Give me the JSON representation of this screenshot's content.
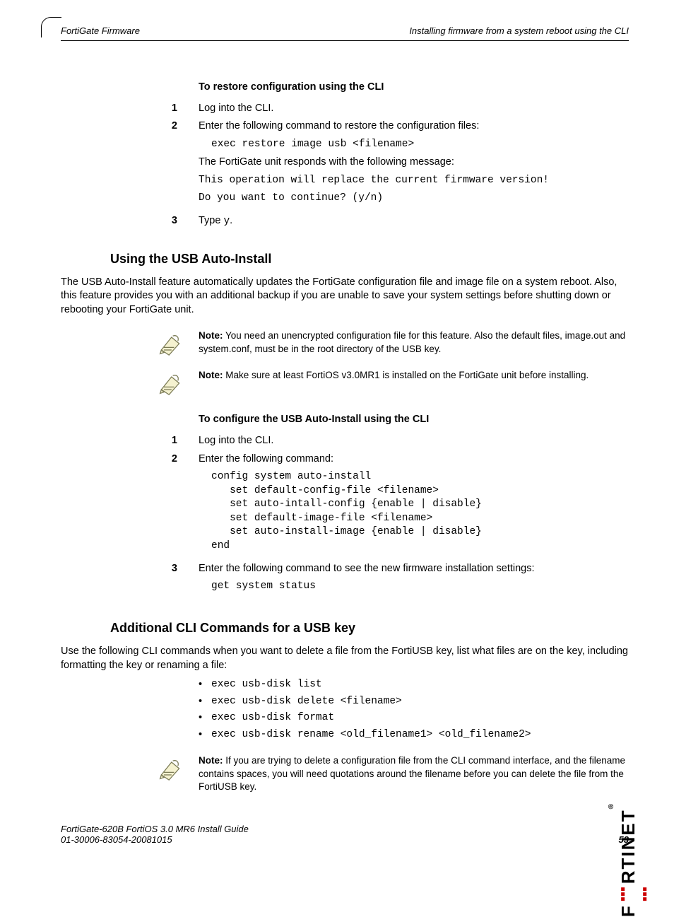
{
  "header": {
    "left": "FortiGate Firmware",
    "right": "Installing firmware from a system reboot using the CLI"
  },
  "proc1": {
    "title": "To restore configuration using the CLI",
    "step1": "Log into the CLI.",
    "step2_intro": "Enter the following command to restore the configuration files:",
    "step2_cmd": "exec restore image usb <filename>",
    "step2_resp_intro": "The FortiGate unit responds with the following message:",
    "step2_resp_line1": "This operation will replace the current firmware version!",
    "step2_resp_line2": "Do you want to continue? (y/n)",
    "step3_pre": "Type ",
    "step3_code": "y",
    "step3_post": "."
  },
  "section1": {
    "heading": "Using the USB Auto-Install",
    "para": "The USB Auto-Install feature automatically updates the FortiGate configuration file and image file on a system reboot. Also, this feature provides you with an additional backup if you are unable to save your system settings before shutting down or rebooting your FortiGate unit.",
    "note1_label": "Note:",
    "note1_body": " You need an unencrypted configuration file for this feature. Also the default files, image.out and system.conf, must be in the root directory of the USB key.",
    "note2_label": "Note:",
    "note2_body": " Make sure at least FortiOS v3.0MR1 is installed on the FortiGate unit before installing."
  },
  "proc2": {
    "title": "To configure the USB Auto-Install using the CLI",
    "step1": "Log into the CLI.",
    "step2_intro": "Enter the following command:",
    "step2_code": "config system auto-install\n   set default-config-file <filename>\n   set auto-intall-config {enable | disable}\n   set default-image-file <filename>\n   set auto-install-image {enable | disable}\nend",
    "step3_intro": "Enter the following command to see the new firmware installation settings:",
    "step3_code": "get system status"
  },
  "section2": {
    "heading": "Additional CLI Commands for a USB key",
    "para": "Use the following CLI commands when you want to delete a file from the FortiUSB key, list what files are on the key, including formatting the key or renaming a file:",
    "cmds": {
      "c1": "exec usb-disk list",
      "c2": "exec usb-disk delete <filename>",
      "c3": "exec usb-disk format",
      "c4": "exec usb-disk rename <old_filename1> <old_filename2>"
    },
    "note_label": "Note:",
    "note_body": " If you are trying to delete a configuration file from the CLI command interface, and the filename contains spaces, you will need quotations around the filename before you can delete the file from the FortiUSB key."
  },
  "footer": {
    "line1": "FortiGate-620B FortiOS 3.0 MR6 Install Guide",
    "line2": "01-30006-83054-20081015",
    "page": "53"
  },
  "brand": "F   RTINET",
  "nums": {
    "n1": "1",
    "n2": "2",
    "n3": "3"
  }
}
